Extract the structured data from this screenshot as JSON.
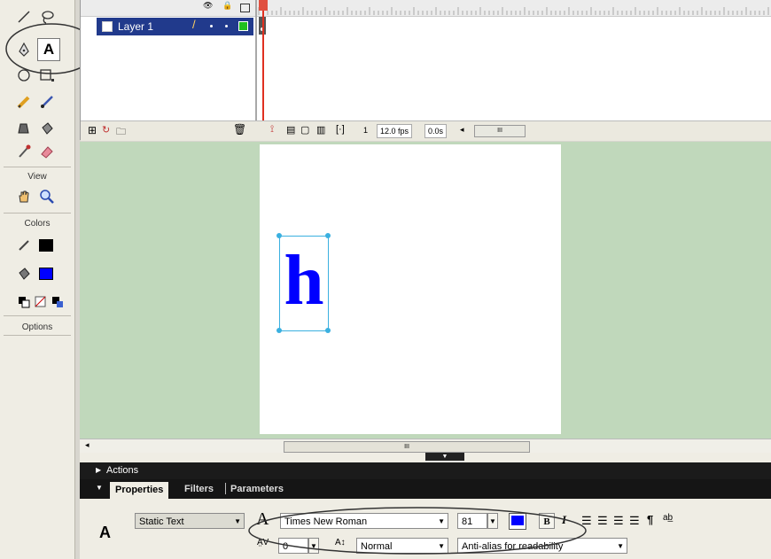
{
  "toolbar": {
    "view_label": "View",
    "colors_label": "Colors",
    "options_label": "Options",
    "text_tool_glyph": "A",
    "stroke_color": "#000000",
    "fill_color": "#0000ff"
  },
  "timeline": {
    "layer_name": "Layer 1",
    "current_frame": "1",
    "frame_rate": "12.0 fps",
    "elapsed_time": "0.0s",
    "scroll_glyph": "◂",
    "scroll_thumb": "III"
  },
  "stage": {
    "text_content": "h",
    "text_color": "#0000ff",
    "background": "#c0d8bb",
    "hscroll_thumb": "III"
  },
  "panels": {
    "actions_label": "Actions",
    "tabs": {
      "properties": "Properties",
      "filters": "Filters",
      "parameters": "Parameters"
    }
  },
  "properties": {
    "tool_glyph": "A",
    "text_type": "Static Text",
    "font_glyph": "A",
    "font_family": "Times New Roman",
    "font_size": "81",
    "text_color": "#0000ff",
    "bold_label": "B",
    "italic_label": "I",
    "paragraph_glyph": "¶",
    "letter_spacing_label": "A̤V",
    "letter_spacing": "0",
    "baseline_label": "A↕",
    "char_position": "Normal",
    "anti_alias": "Anti-alias for readability"
  }
}
